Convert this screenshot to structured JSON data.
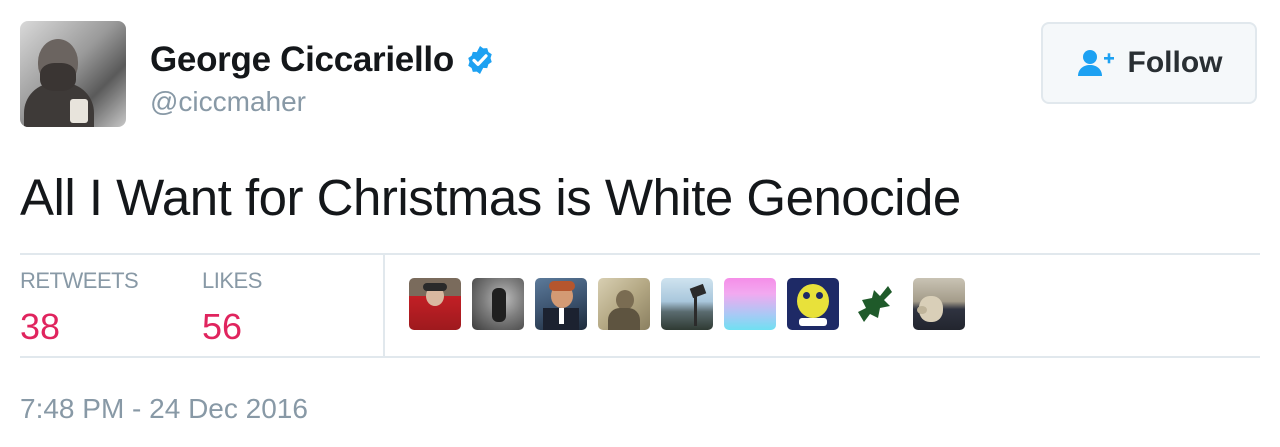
{
  "user": {
    "display_name": "George Ciccariello",
    "handle": "@ciccmaher",
    "verified": true,
    "avatar_icon": "profile-photo"
  },
  "follow_button": {
    "label": "Follow",
    "icon": "follow-person-plus-icon"
  },
  "tweet": {
    "text": "All I Want for Christmas is White Genocide",
    "timestamp": "7:48 PM - 24 Dec 2016"
  },
  "stats": {
    "retweets_label": "RETWEETS",
    "retweets_count": "38",
    "likes_label": "LIKES",
    "likes_count": "56"
  },
  "likers": [
    {
      "name": "liker-avatar-1"
    },
    {
      "name": "liker-avatar-2"
    },
    {
      "name": "liker-avatar-3"
    },
    {
      "name": "liker-avatar-4"
    },
    {
      "name": "liker-avatar-5"
    },
    {
      "name": "liker-avatar-6"
    },
    {
      "name": "liker-avatar-7"
    },
    {
      "name": "liker-avatar-8"
    },
    {
      "name": "liker-avatar-9"
    }
  ],
  "colors": {
    "verified_blue": "#1da1f2",
    "stat_value_red": "#e0245e",
    "secondary_text": "#8899a6",
    "follow_icon_blue": "#1da1f2"
  }
}
